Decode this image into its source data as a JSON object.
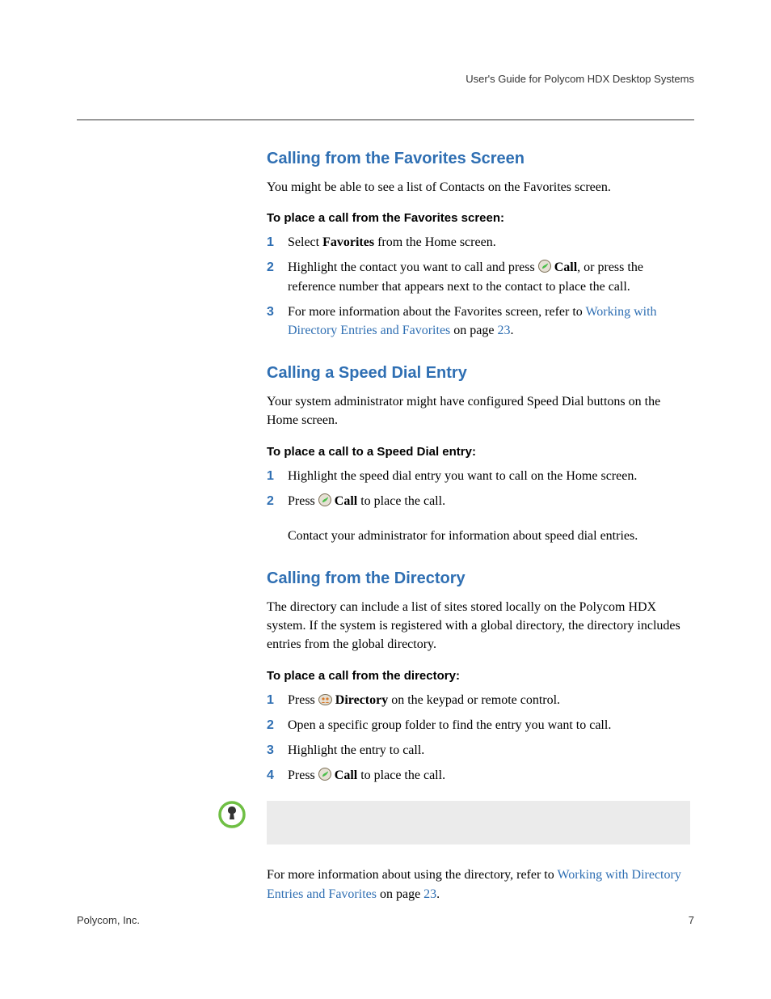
{
  "header": {
    "running_title": "User's Guide for Polycom HDX Desktop Systems"
  },
  "sections": [
    {
      "heading": "Calling from the Favorites Screen",
      "intro": "You might be able to see a list of Contacts on the Favorites screen.",
      "subhead": "To place a call from the Favorites screen:",
      "steps": [
        {
          "n": "1",
          "pre": "Select ",
          "bold": "Favorites",
          "post": " from the Home screen."
        },
        {
          "n": "2",
          "pre": "Highlight the contact you want to call and press ",
          "icon": "call",
          "bold": " Call",
          "post": ", or press the reference number that appears next to the contact to place the call."
        },
        {
          "n": "3",
          "pre": "For more information about the Favorites screen, refer to ",
          "link": "Working with Directory Entries and Favorites",
          "mid": " on page ",
          "pagelink": "23",
          "post": "."
        }
      ]
    },
    {
      "heading": "Calling a Speed Dial Entry",
      "intro": "Your system administrator might have configured Speed Dial buttons on the Home screen.",
      "subhead": "To place a call to a Speed Dial entry:",
      "steps": [
        {
          "n": "1",
          "pre": "Highlight the speed dial entry you want to call on the Home screen."
        },
        {
          "n": "2",
          "pre": "Press ",
          "icon": "call",
          "bold": " Call",
          "post": " to place the call."
        }
      ],
      "extra": "Contact your administrator for information about speed dial entries."
    },
    {
      "heading": "Calling from the Directory",
      "intro": "The directory can include a list of sites stored locally on the Polycom HDX system. If the system is registered with a global directory, the directory includes entries from the global directory.",
      "subhead": "To place a call from the directory:",
      "steps": [
        {
          "n": "1",
          "pre": "Press ",
          "icon": "directory",
          "bold": " Directory",
          "post": " on the keypad or remote control."
        },
        {
          "n": "2",
          "pre": "Open a specific group folder to find the entry you want to call."
        },
        {
          "n": "3",
          "pre": "Highlight the entry to call."
        },
        {
          "n": "4",
          "pre": "Press ",
          "icon": "call",
          "bold": " Call",
          "post": " to place the call."
        }
      ],
      "note": "",
      "closing_pre": "For more information about using the directory, refer to ",
      "closing_link": "Working with Directory Entries and Favorites",
      "closing_mid": " on page ",
      "closing_pagelink": "23",
      "closing_post": "."
    }
  ],
  "footer": {
    "company": "Polycom, Inc.",
    "page": "7"
  }
}
